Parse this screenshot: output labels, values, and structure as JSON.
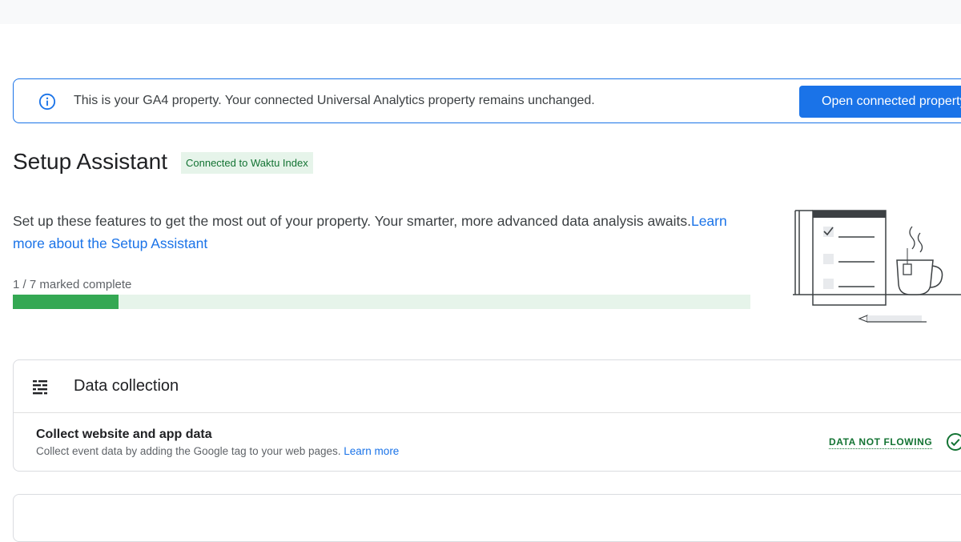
{
  "banner": {
    "message": "This is your GA4 property. Your connected Universal Analytics property remains unchanged.",
    "button_label": "Open connected property"
  },
  "page": {
    "title": "Setup Assistant",
    "connection_chip": "Connected to Waktu Index"
  },
  "intro": {
    "text": "Set up these features to get the most out of your property. Your smarter, more advanced data analysis awaits.",
    "link_label": "Learn more about the Setup Assistant"
  },
  "progress": {
    "label": "1 / 7 marked complete",
    "completed": 1,
    "total": 7
  },
  "data_collection": {
    "section_title": "Data collection",
    "task_title": "Collect website and app data",
    "task_description": "Collect event data by adding the Google tag to your web pages.",
    "task_link": "Learn more",
    "status_label": "DATA NOT FLOWING"
  },
  "colors": {
    "accent": "#1a73e8",
    "success": "#137333",
    "progress_fill": "#34a853",
    "progress_track": "#e6f4ea"
  },
  "icons": [
    "info-icon",
    "data-collection-icon",
    "check-circle-icon",
    "setup-illustration"
  ]
}
